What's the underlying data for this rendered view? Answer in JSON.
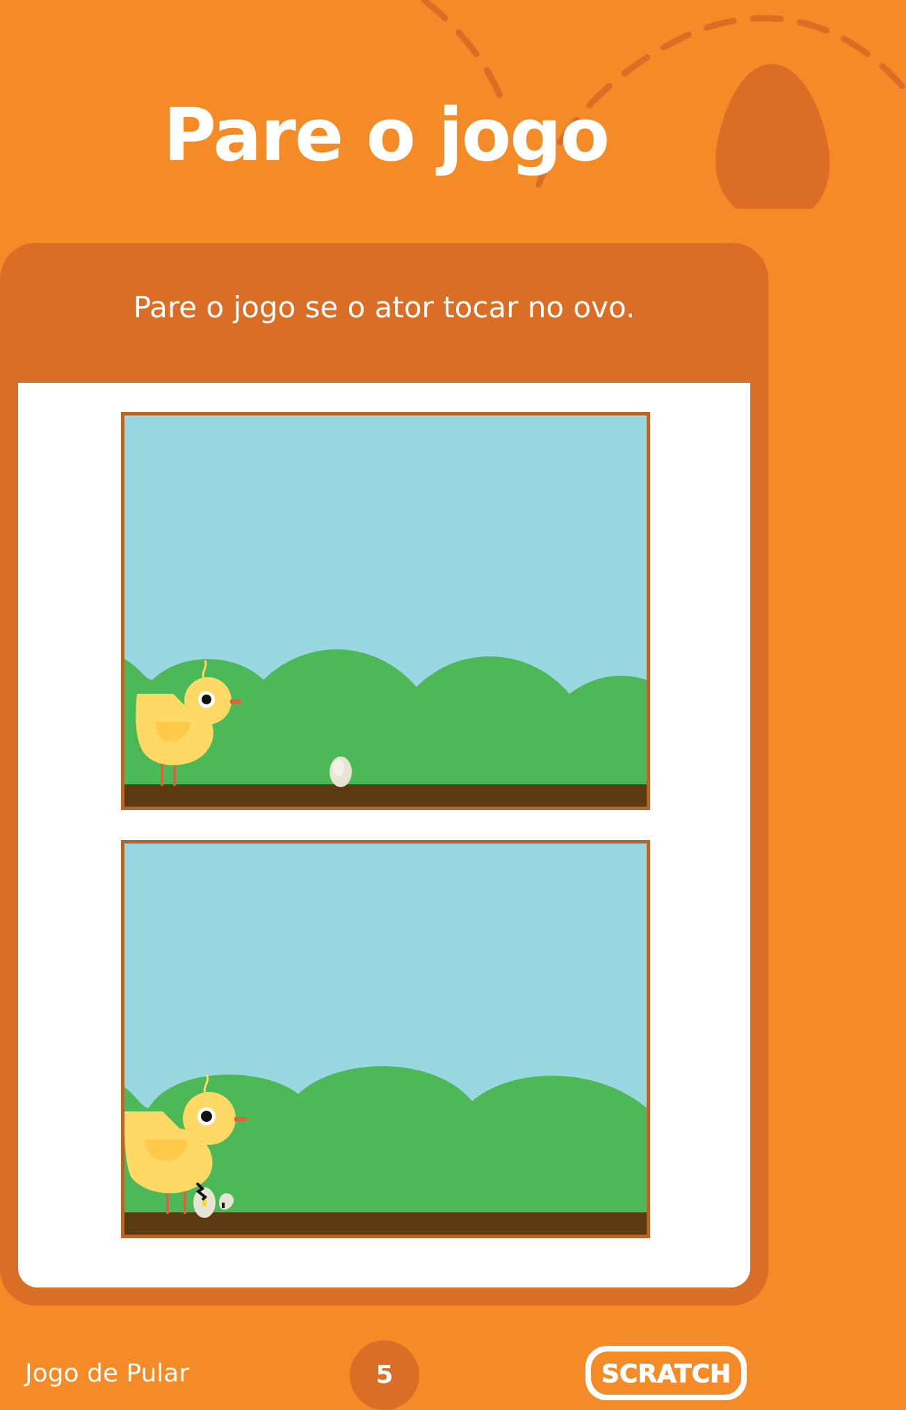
{
  "page": {
    "title": "Pare o jogo",
    "instruction": "Pare o jogo se o ator tocar no ovo.",
    "footer_label": "Jogo de Pular",
    "page_number": "5",
    "logo_text": "SCRATCH"
  },
  "colors": {
    "background": "#F58B26",
    "card": "#DA6E27",
    "sky": "#9AD8E1",
    "grass": "#4CB857",
    "ground": "#5C3A12",
    "chick": "#FFD966",
    "frame": "#B7662B"
  },
  "stages": [
    {
      "name": "stage-before",
      "description_icon": "chick-and-egg"
    },
    {
      "name": "stage-after",
      "description_icon": "chick-and-cracked-egg"
    }
  ]
}
